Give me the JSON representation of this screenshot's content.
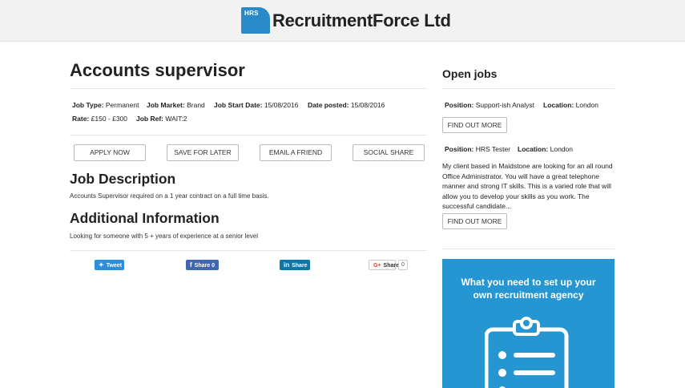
{
  "header": {
    "logo_badge": "HRS",
    "brand": "RecruitmentForce Ltd"
  },
  "job": {
    "title": "Accounts supervisor",
    "meta": {
      "type_label": "Job Type:",
      "type": "Permanent",
      "market_label": "Job Market:",
      "market": "Brand",
      "start_label": "Job Start Date:",
      "start": "15/08/2016",
      "posted_label": "Date posted:",
      "posted": "15/08/2016",
      "rate_label": "Rate:",
      "rate": "£150 - £300",
      "ref_label": "Job Ref:",
      "ref": "WAIT:2"
    },
    "actions": {
      "apply": "APPLY NOW",
      "save": "SAVE FOR LATER",
      "email": "EMAIL A FRIEND",
      "social": "SOCIAL SHARE"
    },
    "description_heading": "Job Description",
    "description": "Accounts Supervisor required on a 1 year contract on a full time basis.",
    "additional_heading": "Additional Information",
    "additional": "Looking for someone with 5 + years of experience at a senior level"
  },
  "share": {
    "twitter_label": "Tweet",
    "facebook_label": "Share 0",
    "linkedin_label": "Share",
    "google_label": "Share",
    "google_count": "0"
  },
  "sidebar": {
    "title": "Open jobs",
    "jobs": [
      {
        "position_label": "Position:",
        "position": "Support-ish Analyst",
        "location_label": "Location:",
        "location": "London",
        "button": "FIND OUT MORE"
      },
      {
        "position_label": "Position:",
        "position": "HRS Tester",
        "location_label": "Location:",
        "location": "London",
        "description": "My client based in Maidstone are looking for an all round Office Administrator. You will have a great telephone manner and strong IT skills. This is a varied role that will allow you to develop your skills as you work. The successful candidate...",
        "button": "FIND OUT MORE"
      }
    ],
    "promo": {
      "line1": "What you need to set up your",
      "line2": "own recruitment agency"
    }
  }
}
